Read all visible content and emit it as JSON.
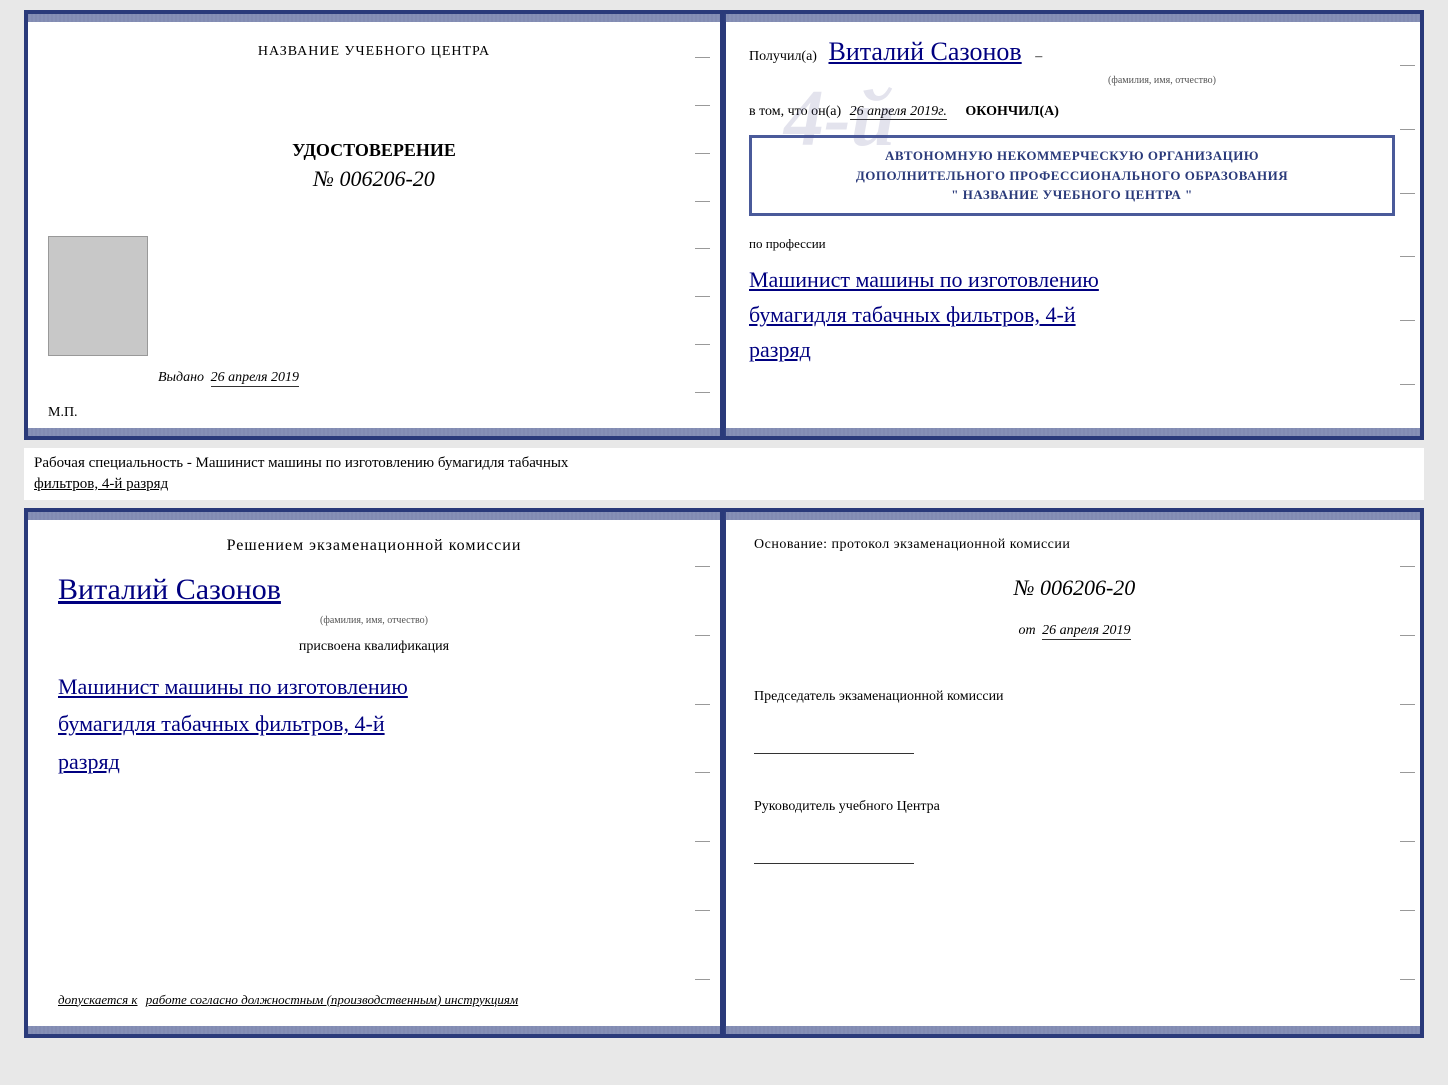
{
  "top": {
    "left": {
      "school_name_label": "НАЗВАНИЕ УЧЕБНОГО ЦЕНТРА",
      "udostoverenie": "УДОСТОВЕРЕНИЕ",
      "number": "№ 006206-20",
      "vydano_prefix": "Выдано",
      "vydano_date": "26 апреля 2019",
      "mp_label": "М.П."
    },
    "right": {
      "poluchil_prefix": "Получил(а)",
      "handwritten_name": "Виталий Сазонов",
      "fio_label": "(фамилия, имя, отчество)",
      "vtom_prefix": "в том, что он(а)",
      "vtom_date": "26 апреля 2019г.",
      "okonchil": "окончил(а)",
      "stamp_line1": "АВТОНОМНУЮ НЕКОММЕРЧЕСКУЮ ОРГАНИЗАЦИЮ",
      "stamp_line2": "ДОПОЛНИТЕЛЬНОГО ПРОФЕССИОНАЛЬНОГО ОБРАЗОВАНИЯ",
      "stamp_line3": "\" НАЗВАНИЕ УЧЕБНОГО ЦЕНТРА \"",
      "po_professii": "по профессии",
      "profession_line1": "Машинист машины по изготовлению",
      "profession_line2": "бумагидля табачных фильтров, 4-й",
      "profession_line3": "разряд"
    }
  },
  "between": {
    "text": "Рабочая специальность - Машинист машины по изготовлению бумагидля табачных",
    "text2": "фильтров, 4-й разряд"
  },
  "bottom": {
    "left": {
      "resheniem": "Решением  экзаменационной  комиссии",
      "handwritten_name": "Виталий Сазонов",
      "fio_label": "(фамилия, имя, отчество)",
      "prisvoena": "присвоена квалификация",
      "profession_line1": "Машинист  машины  по  изготовлению",
      "profession_line2": "бумагидля табачных фильтров, 4-й",
      "profession_line3": "разряд",
      "dopuskaetsya": "допускается к",
      "dopuskaetsya_italic": "работе согласно должностным (производственным) инструкциям"
    },
    "right": {
      "osnovanie": "Основание: протокол экзаменационной  комиссии",
      "number": "№  006206-20",
      "ot_prefix": "от",
      "ot_date": "26 апреля 2019",
      "predsedatel": "Председатель экзаменационной комиссии",
      "rukovoditel": "Руководитель учебного Центра"
    }
  }
}
